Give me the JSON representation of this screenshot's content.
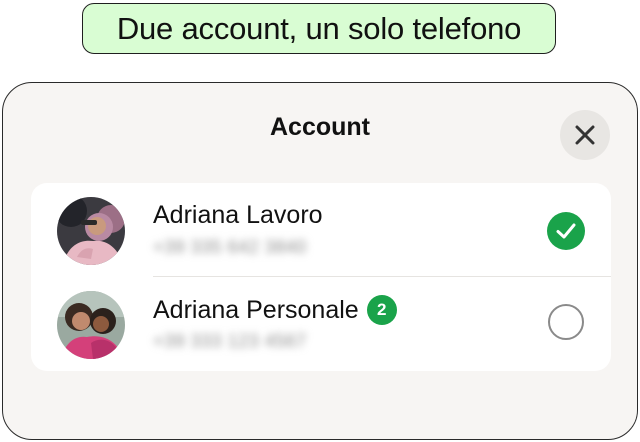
{
  "banner": {
    "text": "Due account, un solo telefono"
  },
  "sheet": {
    "title": "Account",
    "close_icon": "close-icon"
  },
  "accounts": [
    {
      "name": "Adriana Lavoro",
      "phone": "+39 335 642 3840",
      "selected": true,
      "avatar_icon": "avatar-photo"
    },
    {
      "name": "Adriana Personale",
      "badge": "2",
      "phone": "+39 333 123 4567",
      "selected": false,
      "avatar_icon": "avatar-photo"
    }
  ],
  "colors": {
    "banner_bg": "#d9fdd3",
    "sheet_bg": "#f7f5f3",
    "accent_green": "#1aa34a"
  }
}
